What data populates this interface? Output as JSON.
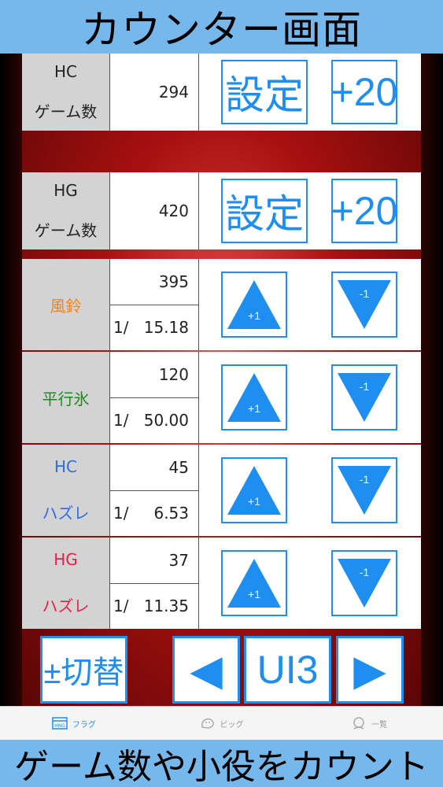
{
  "header": {
    "title": "カウンター画面"
  },
  "footer_banner": {
    "text": "ゲーム数や小役をカウント"
  },
  "game_rows": [
    {
      "label_line1": "HC",
      "label_line2": "ゲーム数",
      "value": "294",
      "set_label": "設定",
      "plus_label": "+20"
    },
    {
      "label_line1": "HG",
      "label_line2": "ゲーム数",
      "value": "420",
      "set_label": "設定",
      "plus_label": "+20"
    }
  ],
  "counter_rows": [
    {
      "label_line1": "風鈴",
      "label_line2": "",
      "label_color": "#f0821e",
      "count": "395",
      "ratio_prefix": "1/",
      "ratio": "15.18",
      "inc_label": "+1",
      "dec_label": "-1"
    },
    {
      "label_line1": "平行氷",
      "label_line2": "",
      "label_color": "#1e8a1e",
      "count": "120",
      "ratio_prefix": "1/",
      "ratio": "50.00",
      "inc_label": "+1",
      "dec_label": "-1"
    },
    {
      "label_line1": "HC",
      "label_line2": "ハズレ",
      "label_color": "#2a6ee8",
      "count": "45",
      "ratio_prefix": "1/",
      "ratio": "6.53",
      "inc_label": "+1",
      "dec_label": "-1"
    },
    {
      "label_line1": "HG",
      "label_line2": "ハズレ",
      "label_color": "#e81e4a",
      "count": "37",
      "ratio_prefix": "1/",
      "ratio": "11.35",
      "inc_label": "+1",
      "dec_label": "-1"
    }
  ],
  "controls": {
    "switch_label": "±切替",
    "prev_label": "◀",
    "mode_label": "UI3",
    "next_label": "▶"
  },
  "tabs": [
    {
      "label": "フラグ",
      "icon": "flag-icon",
      "active": true
    },
    {
      "label": "ビッグ",
      "icon": "big-icon",
      "active": false
    },
    {
      "label": "一覧",
      "icon": "list-icon",
      "active": false
    }
  ],
  "colors": {
    "accent": "#1e8ef0",
    "banner": "#76b8ec"
  }
}
